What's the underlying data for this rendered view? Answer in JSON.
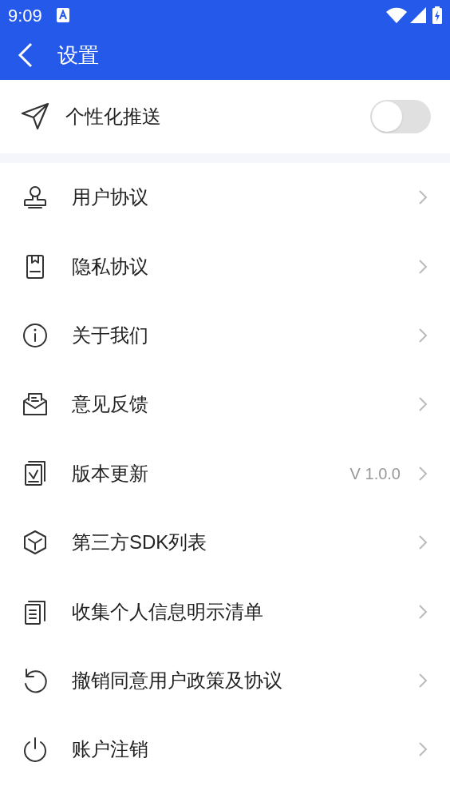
{
  "status_bar": {
    "time": "9:09"
  },
  "app_bar": {
    "title": "设置"
  },
  "push_setting": {
    "label": "个性化推送",
    "on": false
  },
  "items": [
    {
      "label": "用户协议"
    },
    {
      "label": "隐私协议"
    },
    {
      "label": "关于我们"
    },
    {
      "label": "意见反馈"
    },
    {
      "label": "版本更新",
      "value": "V 1.0.0"
    },
    {
      "label": "第三方SDK列表"
    },
    {
      "label": "收集个人信息明示清单"
    },
    {
      "label": "撤销同意用户政策及协议"
    },
    {
      "label": "账户注销"
    }
  ]
}
